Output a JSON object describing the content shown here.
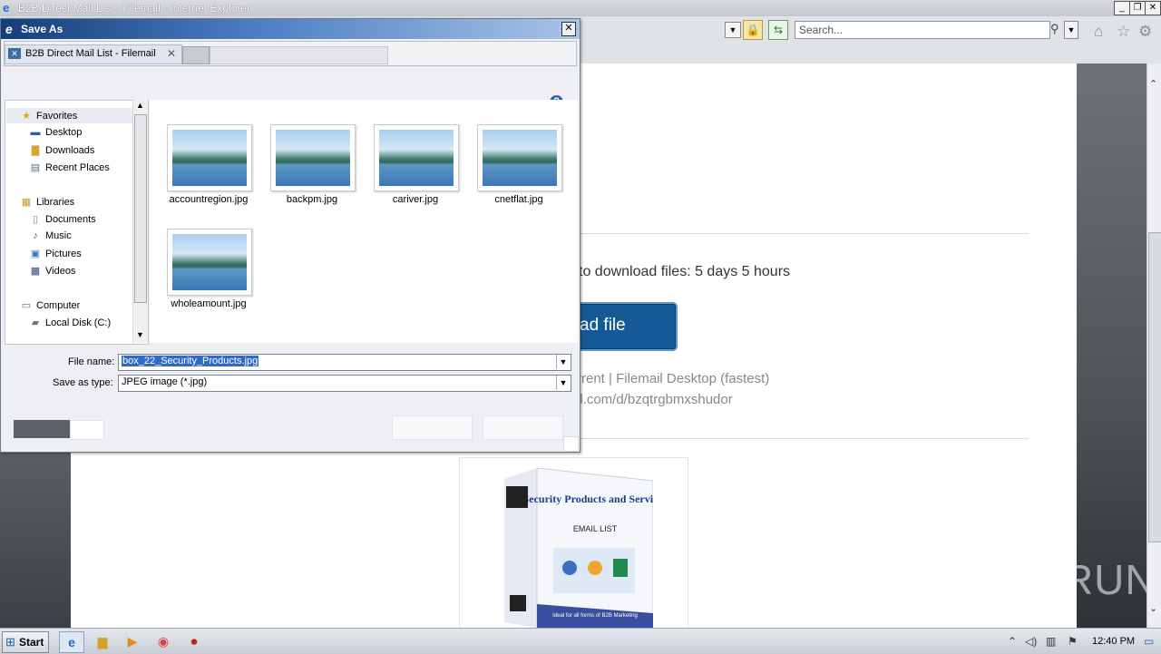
{
  "browser": {
    "window_title": "B2B Direct Mail List - Filemail - Internet Explorer",
    "search_placeholder": "Search..."
  },
  "page": {
    "expire_text": "to download files: 5 days 5 hours",
    "download_button": "ad file",
    "links_text": "rrent  |  Filemail Desktop (fastest)",
    "url_text": "il.com/d/bzqtrgbmxshudor",
    "product": {
      "title": "Security Products and Services",
      "subtitle": "EMAIL LIST",
      "tagline": "Ideal for all forms of B2B Marketing"
    },
    "watermark": "ANY▷RUN"
  },
  "dialog": {
    "title": "Save As",
    "tab_label": "B2B Direct Mail List - Filemail",
    "nav": {
      "favorites": "Favorites",
      "desktop": "Desktop",
      "downloads": "Downloads",
      "recent_places": "Recent Places",
      "libraries": "Libraries",
      "documents": "Documents",
      "music": "Music",
      "pictures": "Pictures",
      "videos": "Videos",
      "computer": "Computer",
      "local_disk": "Local Disk (C:)"
    },
    "files": [
      {
        "name": "accountregion.jpg"
      },
      {
        "name": "backpm.jpg"
      },
      {
        "name": "cariver.jpg"
      },
      {
        "name": "cnetflat.jpg"
      },
      {
        "name": "wholeamount.jpg"
      }
    ],
    "file_name_label": "File name:",
    "file_name_value": "box_22_Security_Products.jpg",
    "save_type_label": "Save as type:",
    "save_type_value": "JPEG image (*.jpg)"
  },
  "taskbar": {
    "start": "Start",
    "clock": "12:40 PM"
  },
  "colors": {
    "download_button": "#155a97",
    "dialog_title_start": "#153d7a",
    "selection": "#316ac5"
  }
}
